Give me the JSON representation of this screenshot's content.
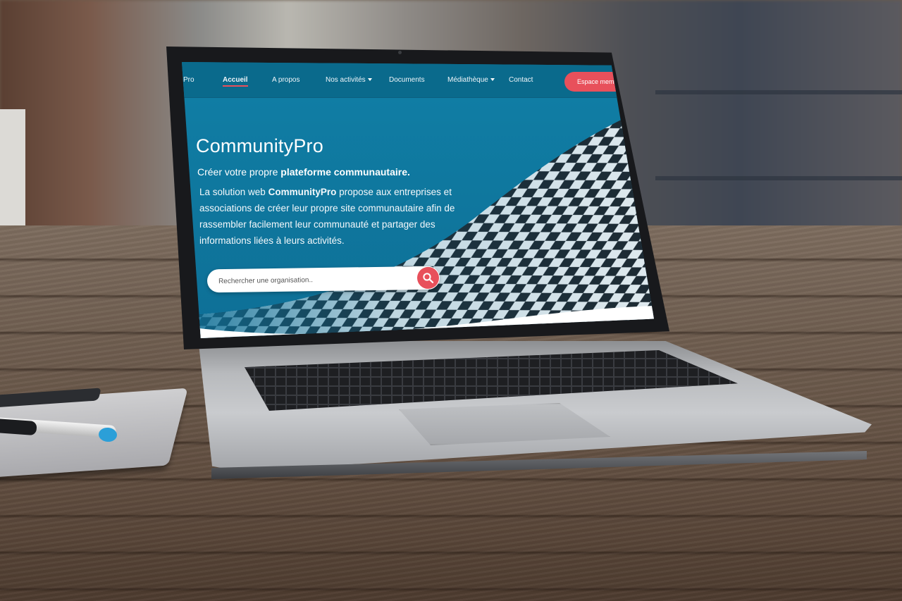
{
  "site": {
    "brand_partial": "Pro",
    "accent_color": "#e8505b",
    "primary_color": "#0e6f96"
  },
  "nav": {
    "items": [
      {
        "label": "Accueil",
        "active": true,
        "has_dropdown": false
      },
      {
        "label": "A propos",
        "active": false,
        "has_dropdown": false
      },
      {
        "label": "Nos activités",
        "active": false,
        "has_dropdown": true
      },
      {
        "label": "Documents",
        "active": false,
        "has_dropdown": false
      },
      {
        "label": "Médiathèque",
        "active": false,
        "has_dropdown": true
      },
      {
        "label": "Contact",
        "active": false,
        "has_dropdown": false
      }
    ],
    "cta_label": "Espace membre"
  },
  "hero": {
    "title": "CommunityPro",
    "tagline_prefix": "Créer votre propre ",
    "tagline_bold": "plateforme communautaire.",
    "desc_prefix": "La solution web ",
    "desc_bold": "CommunityPro",
    "desc_suffix": " propose aux entreprises et associations de créer leur propre site communautaire afin de rassembler facilement leur communauté et partager des informations liées à leurs activités."
  },
  "search": {
    "placeholder": "Rechercher une organisation..",
    "icon": "search-icon"
  }
}
